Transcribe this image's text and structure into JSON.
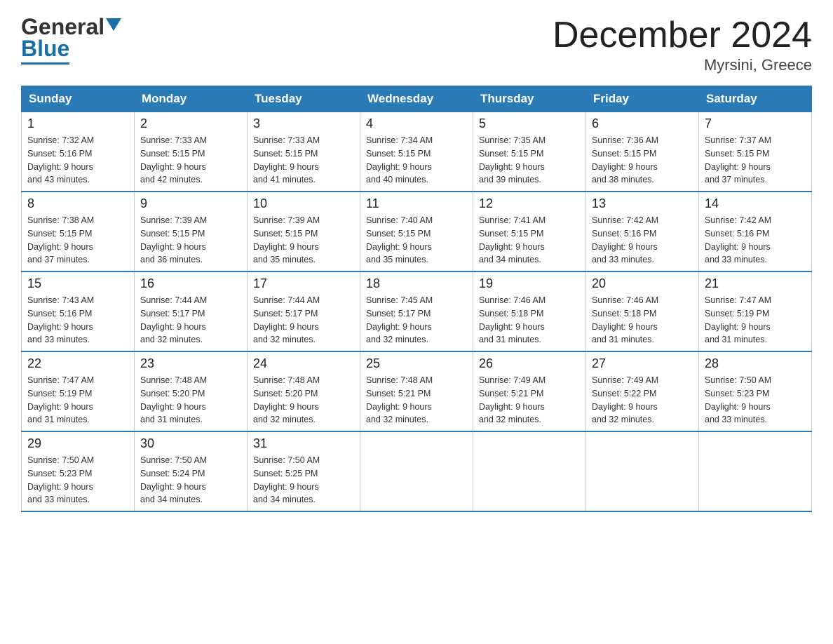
{
  "header": {
    "logo_general": "General",
    "logo_blue": "Blue",
    "month_title": "December 2024",
    "location": "Myrsini, Greece"
  },
  "days_of_week": [
    "Sunday",
    "Monday",
    "Tuesday",
    "Wednesday",
    "Thursday",
    "Friday",
    "Saturday"
  ],
  "weeks": [
    [
      {
        "day": "1",
        "sunrise": "7:32 AM",
        "sunset": "5:16 PM",
        "daylight": "9 hours and 43 minutes."
      },
      {
        "day": "2",
        "sunrise": "7:33 AM",
        "sunset": "5:15 PM",
        "daylight": "9 hours and 42 minutes."
      },
      {
        "day": "3",
        "sunrise": "7:33 AM",
        "sunset": "5:15 PM",
        "daylight": "9 hours and 41 minutes."
      },
      {
        "day": "4",
        "sunrise": "7:34 AM",
        "sunset": "5:15 PM",
        "daylight": "9 hours and 40 minutes."
      },
      {
        "day": "5",
        "sunrise": "7:35 AM",
        "sunset": "5:15 PM",
        "daylight": "9 hours and 39 minutes."
      },
      {
        "day": "6",
        "sunrise": "7:36 AM",
        "sunset": "5:15 PM",
        "daylight": "9 hours and 38 minutes."
      },
      {
        "day": "7",
        "sunrise": "7:37 AM",
        "sunset": "5:15 PM",
        "daylight": "9 hours and 37 minutes."
      }
    ],
    [
      {
        "day": "8",
        "sunrise": "7:38 AM",
        "sunset": "5:15 PM",
        "daylight": "9 hours and 37 minutes."
      },
      {
        "day": "9",
        "sunrise": "7:39 AM",
        "sunset": "5:15 PM",
        "daylight": "9 hours and 36 minutes."
      },
      {
        "day": "10",
        "sunrise": "7:39 AM",
        "sunset": "5:15 PM",
        "daylight": "9 hours and 35 minutes."
      },
      {
        "day": "11",
        "sunrise": "7:40 AM",
        "sunset": "5:15 PM",
        "daylight": "9 hours and 35 minutes."
      },
      {
        "day": "12",
        "sunrise": "7:41 AM",
        "sunset": "5:15 PM",
        "daylight": "9 hours and 34 minutes."
      },
      {
        "day": "13",
        "sunrise": "7:42 AM",
        "sunset": "5:16 PM",
        "daylight": "9 hours and 33 minutes."
      },
      {
        "day": "14",
        "sunrise": "7:42 AM",
        "sunset": "5:16 PM",
        "daylight": "9 hours and 33 minutes."
      }
    ],
    [
      {
        "day": "15",
        "sunrise": "7:43 AM",
        "sunset": "5:16 PM",
        "daylight": "9 hours and 33 minutes."
      },
      {
        "day": "16",
        "sunrise": "7:44 AM",
        "sunset": "5:17 PM",
        "daylight": "9 hours and 32 minutes."
      },
      {
        "day": "17",
        "sunrise": "7:44 AM",
        "sunset": "5:17 PM",
        "daylight": "9 hours and 32 minutes."
      },
      {
        "day": "18",
        "sunrise": "7:45 AM",
        "sunset": "5:17 PM",
        "daylight": "9 hours and 32 minutes."
      },
      {
        "day": "19",
        "sunrise": "7:46 AM",
        "sunset": "5:18 PM",
        "daylight": "9 hours and 31 minutes."
      },
      {
        "day": "20",
        "sunrise": "7:46 AM",
        "sunset": "5:18 PM",
        "daylight": "9 hours and 31 minutes."
      },
      {
        "day": "21",
        "sunrise": "7:47 AM",
        "sunset": "5:19 PM",
        "daylight": "9 hours and 31 minutes."
      }
    ],
    [
      {
        "day": "22",
        "sunrise": "7:47 AM",
        "sunset": "5:19 PM",
        "daylight": "9 hours and 31 minutes."
      },
      {
        "day": "23",
        "sunrise": "7:48 AM",
        "sunset": "5:20 PM",
        "daylight": "9 hours and 31 minutes."
      },
      {
        "day": "24",
        "sunrise": "7:48 AM",
        "sunset": "5:20 PM",
        "daylight": "9 hours and 32 minutes."
      },
      {
        "day": "25",
        "sunrise": "7:48 AM",
        "sunset": "5:21 PM",
        "daylight": "9 hours and 32 minutes."
      },
      {
        "day": "26",
        "sunrise": "7:49 AM",
        "sunset": "5:21 PM",
        "daylight": "9 hours and 32 minutes."
      },
      {
        "day": "27",
        "sunrise": "7:49 AM",
        "sunset": "5:22 PM",
        "daylight": "9 hours and 32 minutes."
      },
      {
        "day": "28",
        "sunrise": "7:50 AM",
        "sunset": "5:23 PM",
        "daylight": "9 hours and 33 minutes."
      }
    ],
    [
      {
        "day": "29",
        "sunrise": "7:50 AM",
        "sunset": "5:23 PM",
        "daylight": "9 hours and 33 minutes."
      },
      {
        "day": "30",
        "sunrise": "7:50 AM",
        "sunset": "5:24 PM",
        "daylight": "9 hours and 34 minutes."
      },
      {
        "day": "31",
        "sunrise": "7:50 AM",
        "sunset": "5:25 PM",
        "daylight": "9 hours and 34 minutes."
      },
      null,
      null,
      null,
      null
    ]
  ],
  "labels": {
    "sunrise": "Sunrise: ",
    "sunset": "Sunset: ",
    "daylight": "Daylight: "
  }
}
